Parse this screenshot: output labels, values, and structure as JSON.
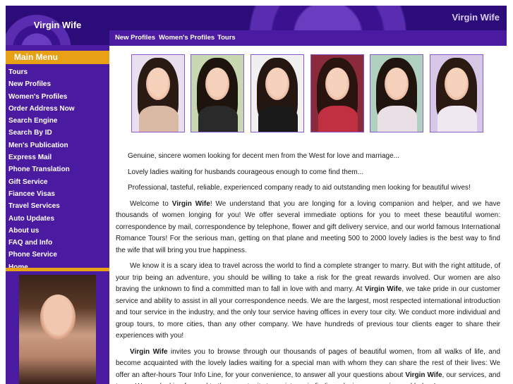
{
  "site": {
    "title": "Virgin Wife",
    "banner_title": "Virgin Wife"
  },
  "topnav": [
    "New Profiles",
    "Women's Profiles",
    "Tours"
  ],
  "menu": {
    "header": "Main Menu",
    "items": [
      "Tours",
      "New Profiles",
      "Women's Profiles",
      "Order Address Now",
      "Search Engine",
      "Search By ID",
      "Men's Publication",
      "Express Mail",
      "Phone Translation",
      "Gift Service",
      "Fiancee Visas",
      "Travel Services",
      "Auto Updates",
      "About us",
      "FAQ and Info",
      "Phone Service",
      "Home"
    ]
  },
  "intro": [
    "Genuine, sincere women looking for decent men from the West for love and marriage...",
    "Lovely ladies waiting for husbands courageous enough to come find them...",
    "Professional, tasteful, reliable, experienced company ready to aid outstanding men looking for beautiful wives!"
  ],
  "p1": {
    "a": "Welcome to ",
    "brand": "Virgin Wife",
    "b": "! We understand that you are longing for a loving companion and helper, and we have thousands of women longing for you! We offer several immediate options for you to meet these beautiful women: correspondence by mail, correspondence by telephone, flower and gift delivery service, and our world famous International Romance Tours! For the serious man, getting on that plane and meeting 500 to 2000 lovely ladies is the best way to find the wife that will bring you true happiness."
  },
  "p2": {
    "a": "We know it is a scary idea to travel across the world to find a complete stranger to marry. But with the right attitude, of your trip being an adventure, you should be willing to take a risk for the great rewards involved. Our women are also braving the unknown to find a committed man to fall in love with and marry. At ",
    "brand": "Virgin Wife",
    "b": ", we take pride in our customer service and ability to assist in all your correspondence needs. We are the largest, most respected international introduction and tour service in the industry, and the only tour service having offices in every tour city. We conduct more individual and group tours, to more cities, than any other company. We have hundreds of previous tour clients eager to share their experiences with you!"
  },
  "p3": {
    "brand1": "Virgin Wife",
    "a": " invites you to browse through our thousands of pages of beautiful women, from all walks of life, and become acquainted with the lovely ladies waiting for a special man with whom they can share the rest of their lives: We offer an after-hours Tour Info Line, for your convenience, to answer all your questions about ",
    "brand2": "Virgin Wife",
    "b": ", our services, and tours. We are looking forward to the opportunity to assist you in finding a loving companion and helper!"
  },
  "colors": {
    "purple": "#4a1aa0",
    "orange": "#e8a017",
    "border": "#8a5ac8"
  }
}
